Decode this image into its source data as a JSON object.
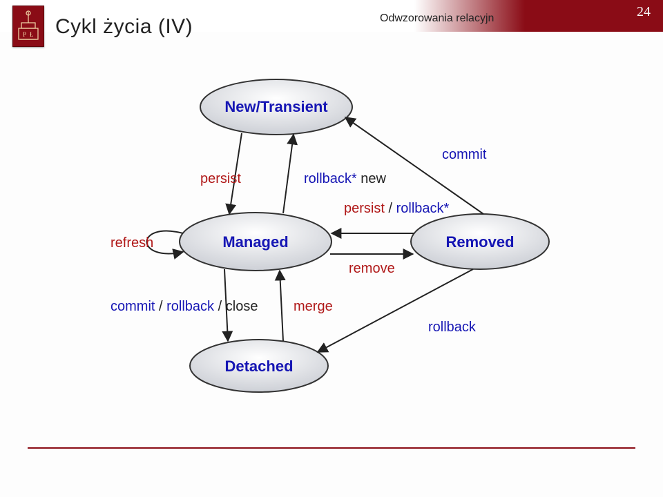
{
  "page_number": "24",
  "title": "Cykl życia (IV)",
  "header_caption": "Odwzorowania relacyjn",
  "states": {
    "new_transient": "New/Transient",
    "managed": "Managed",
    "removed": "Removed",
    "detached": "Detached"
  },
  "labels": {
    "commit": "commit",
    "persist": "persist",
    "rollback_star": "rollback*",
    "new": "new",
    "persist_rollback_star_persist": "persist",
    "persist_rollback_star_rollback": "rollback*",
    "remove": "remove",
    "refresh": "refresh",
    "commit_rollback_close_commit": "commit",
    "commit_rollback_close_rollback": "rollback",
    "commit_rollback_close_close": "close",
    "merge": "merge",
    "rollback": "rollback",
    "slash": "/"
  },
  "colors": {
    "state_fill_light": "#f9f9fa",
    "state_fill_dark": "#d4d6db",
    "state_text": "#1616b4",
    "blue": "#1616b4",
    "red": "#b01818",
    "black": "#222222",
    "stroke": "#333333"
  },
  "chart_data": {
    "type": "diagram",
    "title": "Cykl życia (IV)",
    "nodes": [
      {
        "id": "new_transient",
        "label": "New/Transient"
      },
      {
        "id": "managed",
        "label": "Managed"
      },
      {
        "id": "removed",
        "label": "Removed"
      },
      {
        "id": "detached",
        "label": "Detached"
      }
    ],
    "edges": [
      {
        "from": "new_transient",
        "to": "managed",
        "label": "persist",
        "colors": [
          "red"
        ]
      },
      {
        "from": "managed",
        "to": "new_transient",
        "label": "rollback* new",
        "colors": [
          "blue",
          "black"
        ]
      },
      {
        "from": "removed",
        "to": "new_transient",
        "label": "commit",
        "colors": [
          "blue"
        ]
      },
      {
        "from": "removed",
        "to": "managed",
        "label": "persist/rollback*",
        "colors": [
          "red",
          "blue"
        ]
      },
      {
        "from": "managed",
        "to": "removed",
        "label": "remove",
        "colors": [
          "red"
        ]
      },
      {
        "from": "managed",
        "to": "managed",
        "label": "refresh",
        "colors": [
          "red"
        ],
        "self_loop": true
      },
      {
        "from": "managed",
        "to": "detached",
        "label": "commit/rollback/close",
        "colors": [
          "blue",
          "blue",
          "black"
        ]
      },
      {
        "from": "detached",
        "to": "managed",
        "label": "merge",
        "colors": [
          "red"
        ]
      },
      {
        "from": "removed",
        "to": "detached",
        "label": "rollback",
        "colors": [
          "blue"
        ]
      }
    ]
  }
}
